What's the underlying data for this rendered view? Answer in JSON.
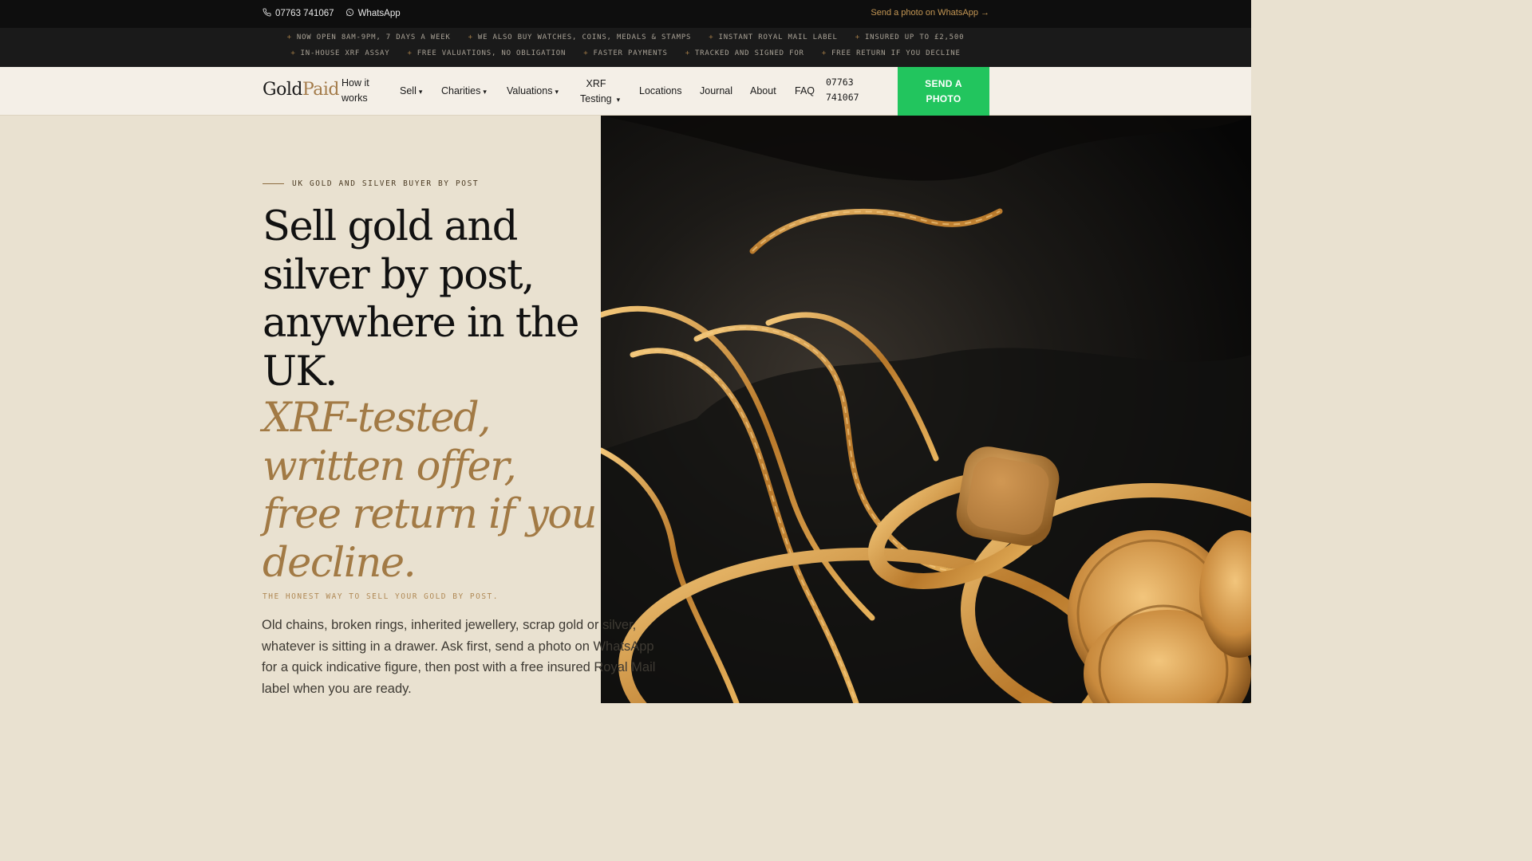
{
  "topbar": {
    "phone": "07763 741067",
    "whatsapp": "WhatsApp",
    "cta": "Send a photo on WhatsApp →",
    "phone_icon": "phone-icon",
    "whatsapp_icon": "whatsapp-icon"
  },
  "ticker": {
    "row1": [
      "NOW OPEN 8AM-9PM, 7 DAYS A WEEK",
      "WE ALSO BUY WATCHES, COINS, MEDALS & STAMPS",
      "INSTANT ROYAL MAIL LABEL",
      "INSURED UP TO £2,500"
    ],
    "row2": [
      "IN-HOUSE XRF ASSAY",
      "FREE VALUATIONS, NO OBLIGATION",
      "FASTER PAYMENTS",
      "TRACKED AND SIGNED FOR",
      "FREE RETURN IF YOU DECLINE"
    ],
    "bullet": "+"
  },
  "nav": {
    "logo_gold": "Gold",
    "logo_paid": "Paid",
    "how_it_works_1": "How it",
    "how_it_works_2": "works",
    "sell": "Sell",
    "charities": "Charities",
    "valuations": "Valuations",
    "xrf_1": "XRF",
    "xrf_2": "Testing",
    "locations": "Locations",
    "journal": "Journal",
    "about": "About",
    "faq": "FAQ",
    "phone_1": "07763",
    "phone_2": "741067",
    "caret": "▾",
    "send_1": "SEND A",
    "send_2": "PHOTO"
  },
  "hero": {
    "eyebrow": "UK GOLD AND SILVER BUYER BY POST",
    "headline": "Sell gold and silver by post, anywhere in the UK.",
    "headline_italic": "XRF-tested, written offer, free return if you decline.",
    "tagline": "THE HONEST WAY TO SELL YOUR GOLD BY POST.",
    "body": "Old chains, broken rings, inherited jewellery, scrap gold or silver, whatever is sitting in a drawer. Ask first, send a photo on WhatsApp for a quick indicative figure, then post with a free insured Royal Mail label when you are ready."
  },
  "colors": {
    "accent_gold": "#a27a45",
    "cta_green": "#22c55e",
    "topbar_bg": "#0e0e0e",
    "hero_bg": "#e9e1d0"
  }
}
